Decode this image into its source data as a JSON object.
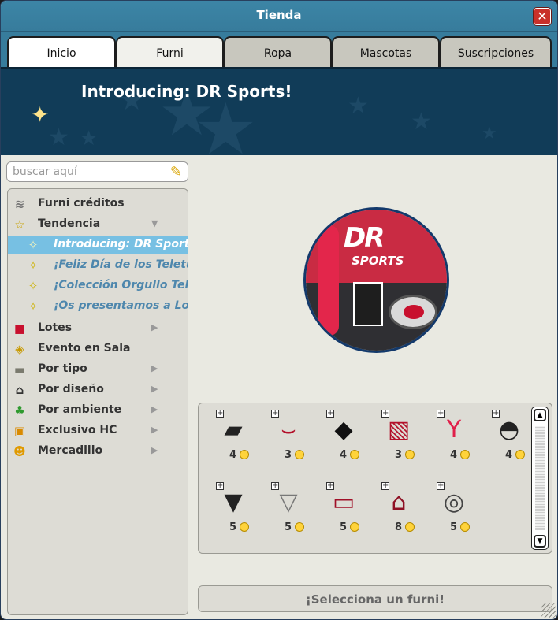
{
  "window": {
    "title": "Tienda",
    "close": "✕"
  },
  "tabs": [
    "Inicio",
    "Furni",
    "Ropa",
    "Mascotas",
    "Suscripciones"
  ],
  "banner": {
    "title": "Introducing: DR Sports!"
  },
  "search": {
    "placeholder": "buscar aquí"
  },
  "sidebar": [
    {
      "label": "Furni créditos",
      "icon": "coins-icon"
    },
    {
      "label": "Tendencia",
      "icon": "star-outline-icon"
    },
    {
      "label": "Introducing: DR Sports!",
      "icon": "sparkle-icon",
      "sub": true,
      "selected": true
    },
    {
      "label": "¡Feliz Día de los Teletubbies",
      "icon": "sparkle-icon",
      "sub": true
    },
    {
      "label": "¡Colección Orgullo Teletubbies",
      "icon": "sparkle-icon",
      "sub": true
    },
    {
      "label": "¡Os presentamos a Los Teletubbies",
      "icon": "sparkle-icon",
      "sub": true
    },
    {
      "label": "Lotes",
      "icon": "box-icon"
    },
    {
      "label": "Evento en Sala",
      "icon": "map-icon"
    },
    {
      "label": "Por tipo",
      "icon": "sofa-icon"
    },
    {
      "label": "Por diseño",
      "icon": "temple-icon"
    },
    {
      "label": "Por ambiente",
      "icon": "plant-icon"
    },
    {
      "label": "Exclusivo HC",
      "icon": "hc-icon"
    },
    {
      "label": "Mercadillo",
      "icon": "trade-icon"
    }
  ],
  "items": [
    {
      "price": "4",
      "icon": "black-bag-icon"
    },
    {
      "price": "3",
      "icon": "garland-icon"
    },
    {
      "price": "4",
      "icon": "black-tile-icon"
    },
    {
      "price": "3",
      "icon": "dr-poster-icon"
    },
    {
      "price": "4",
      "icon": "red-fan-icon"
    },
    {
      "price": "4",
      "icon": "cap-hanger-icon"
    },
    {
      "price": "5",
      "icon": "black-shirt-icon"
    },
    {
      "price": "5",
      "icon": "white-shirt-icon"
    },
    {
      "price": "5",
      "icon": "sneaker-box-icon"
    },
    {
      "price": "8",
      "icon": "stall-icon"
    },
    {
      "price": "5",
      "icon": "ball-rug-icon"
    }
  ],
  "footer": {
    "select_label": "¡Selecciona un furni!"
  },
  "colors": {
    "titlebar": "#377c9c",
    "banner": "#113c58",
    "selected": "#77c0e3",
    "coin": "#ffd33b"
  }
}
